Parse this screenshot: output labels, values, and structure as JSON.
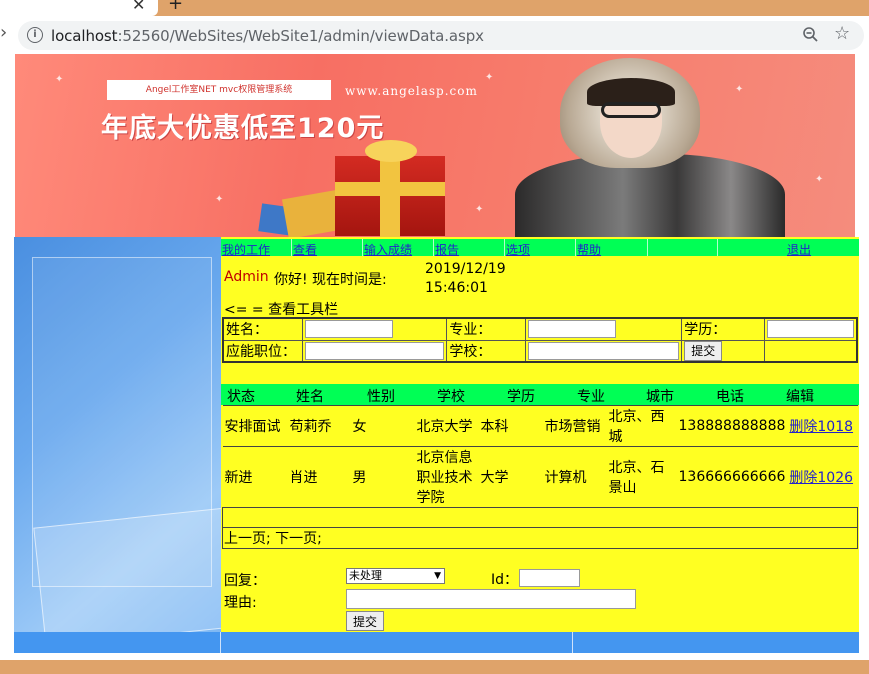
{
  "browser": {
    "close_tab_glyph": "✕",
    "new_tab_glyph": "+",
    "url_host": "localhost",
    "url_rest": ":52560/WebSites/WebSite1/admin/viewData.aspx"
  },
  "banner": {
    "tag": "Angel工作室NET mvc权限管理系统",
    "site": "www.angelasp.com",
    "headline": "年底大优惠低至120元"
  },
  "menu": {
    "items": [
      "我的工作",
      "查看",
      "输入成绩",
      "报告",
      "选项",
      "帮助"
    ],
    "logout": "退出"
  },
  "greeting": {
    "user": "Admin",
    "text": "你好! 现在时间是:",
    "time_date": "2019/12/19",
    "time_clock": "15:46:01"
  },
  "toolbar_link": "<= = 查看工具栏",
  "filter": {
    "name_label": "姓名：",
    "major_label": "专业：",
    "edu_label": "学历：",
    "position_label": "应能职位：",
    "school_label": "学校：",
    "submit_label": "提交"
  },
  "grid": {
    "headers": [
      "状态",
      "姓名",
      "性别",
      "学校",
      "学历",
      "专业",
      "城市",
      "电话",
      "编辑"
    ],
    "rows": [
      {
        "status": "安排面试",
        "name": "苟莉乔",
        "gender": "女",
        "school": "北京大学",
        "edu": "本科",
        "major": "市场营销",
        "city": "北京、西城",
        "phone": "138888888888",
        "edit": "删除1018"
      },
      {
        "status": "新进",
        "name": "肖进",
        "gender": "男",
        "school": "北京信息职业技术学院",
        "edu": "大学",
        "major": "计算机",
        "city": "北京、石景山",
        "phone": "136666666666",
        "edit": "删除1026"
      }
    ],
    "pager": "上一页; 下一页;"
  },
  "reply_form": {
    "reply_label": "回复：",
    "status_value": "未处理",
    "id_label": "Id：",
    "reason_label": "理由:",
    "submit_label": "提交"
  }
}
